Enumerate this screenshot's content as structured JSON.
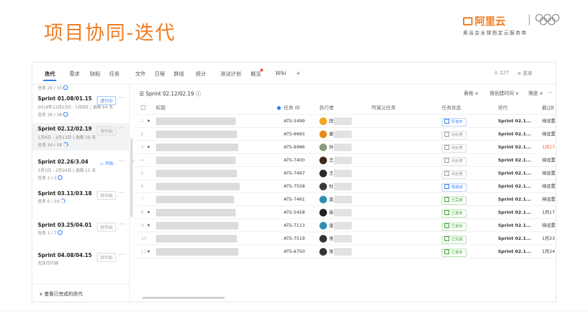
{
  "slide": {
    "title": "项目协同-迭代",
    "logo_brand": "阿里云",
    "logo_sub": "奥运会全球指定云服务商"
  },
  "colors": {
    "accent": "#f07b1f",
    "primary": "#2b7cf6",
    "danger": "#f05a28",
    "success": "#2ea121"
  },
  "nav": {
    "tabs": [
      "迭代",
      "需求",
      "缺陷",
      "任务",
      "文件",
      "日程",
      "群组",
      "统计",
      "测试计划",
      "概览",
      "Wiki",
      "+"
    ],
    "active_tab": "迭代",
    "right_count": "227",
    "right_menu": "菜单"
  },
  "sidebar": {
    "top_text": "任务 29 / 33",
    "sprints": [
      {
        "name": "Sprint 01.08/01.15",
        "status": "进行中",
        "meta": "2019年12月23日 - 1月8日 | 逾期 64 天",
        "count": "任务 36 / 38",
        "active": false
      },
      {
        "name": "Sprint 02.12/02.19",
        "status": "待开始",
        "meta": "1月6日 - 2月13日 | 逾期 29 天",
        "count": "任务 34 / 58",
        "active": true
      },
      {
        "name": "Sprint 02.26/3.04",
        "status": "▷ 开始",
        "meta": "2月3日 - 2月26日 | 逾期 15 天",
        "count": "任务 2 / 3",
        "active": false
      },
      {
        "name": "Sprint 03.11/03.18",
        "status": "待开始",
        "meta": "",
        "count": "任务 6 / 19",
        "active": false
      },
      {
        "name": "Sprint 03.25/04.01",
        "status": "待开始",
        "meta": "",
        "count": "任务 1 / 7",
        "active": false
      },
      {
        "name": "Sprint 04.08/04.15",
        "status": "待开始",
        "meta": "",
        "count": "无迭代内容",
        "active": false
      }
    ],
    "footer": "查看已完成的迭代"
  },
  "toolbar": {
    "title": "Sprint 02.12/02.19",
    "view": "表格",
    "sort": "按创建时间",
    "filter": "筛选"
  },
  "table": {
    "columns": [
      "标题",
      "任务 ID",
      "执行者",
      "所属父任务",
      "任务状态",
      "迭代",
      "截止"
    ],
    "rows": [
      {
        "n": "1",
        "arrow": true,
        "id": "ATS-5499",
        "assignee": "田",
        "avatar": "#f5a623",
        "status": "开发中",
        "status_type": "blue",
        "sprint": "Sprint 02.1...",
        "due": "待设置",
        "due_red": false
      },
      {
        "n": "2",
        "arrow": false,
        "id": "ATS-6665",
        "assignee": "谢",
        "avatar": "#e88a1a",
        "status": "待处理",
        "status_type": "grey",
        "sprint": "Sprint 02.1...",
        "due": "待设置",
        "due_red": false
      },
      {
        "n": "3",
        "arrow": true,
        "id": "ATS-6986",
        "assignee": "孙",
        "avatar": "#8a9a7b",
        "status": "待处理",
        "status_type": "grey",
        "sprint": "Sprint 02.1...",
        "due": "1月17日",
        "due_red": true
      },
      {
        "n": "4",
        "arrow": false,
        "id": "ATS-7400",
        "assignee": "王",
        "avatar": "#3b2a20",
        "status": "待处理",
        "status_type": "grey",
        "sprint": "Sprint 02.1...",
        "due": "待设置",
        "due_red": false
      },
      {
        "n": "5",
        "arrow": false,
        "id": "ATS-7497",
        "assignee": "王",
        "avatar": "#2a2a2a",
        "status": "待处理",
        "status_type": "grey",
        "sprint": "Sprint 02.1...",
        "due": "待设置",
        "due_red": false
      },
      {
        "n": "6",
        "arrow": false,
        "id": "ATS-7558",
        "assignee": "杜",
        "avatar": "#3a3a3a",
        "status": "待测试",
        "status_type": "blue",
        "sprint": "Sprint 02.1...",
        "due": "待设置",
        "due_red": false
      },
      {
        "n": "7",
        "arrow": false,
        "id": "ATS-7461",
        "assignee": "金",
        "avatar": "#2f8fb5",
        "status": "已完成",
        "status_type": "green",
        "sprint": "Sprint 02.1...",
        "due": "待设置",
        "due_red": false
      },
      {
        "n": "8",
        "arrow": true,
        "id": "ATS-5458",
        "assignee": "高",
        "avatar": "#222222",
        "status": "已发布",
        "status_type": "green",
        "sprint": "Sprint 02.1...",
        "due": "1月17日",
        "due_red": false
      },
      {
        "n": "9",
        "arrow": true,
        "id": "ATS-7113",
        "assignee": "金",
        "avatar": "#2f8fb5",
        "status": "已发布",
        "status_type": "green",
        "sprint": "Sprint 02.1...",
        "due": "待设置",
        "due_red": false
      },
      {
        "n": "10",
        "arrow": false,
        "id": "ATS-7519",
        "assignee": "张",
        "avatar": "#333333",
        "status": "已完成",
        "status_type": "green",
        "sprint": "Sprint 02.1...",
        "due": "1月23日",
        "due_red": false
      },
      {
        "n": "11",
        "arrow": true,
        "id": "ATS-6750",
        "assignee": "张",
        "avatar": "#333333",
        "status": "已发布",
        "status_type": "green",
        "sprint": "Sprint 02.1...",
        "due": "1月24日",
        "due_red": false
      }
    ]
  }
}
